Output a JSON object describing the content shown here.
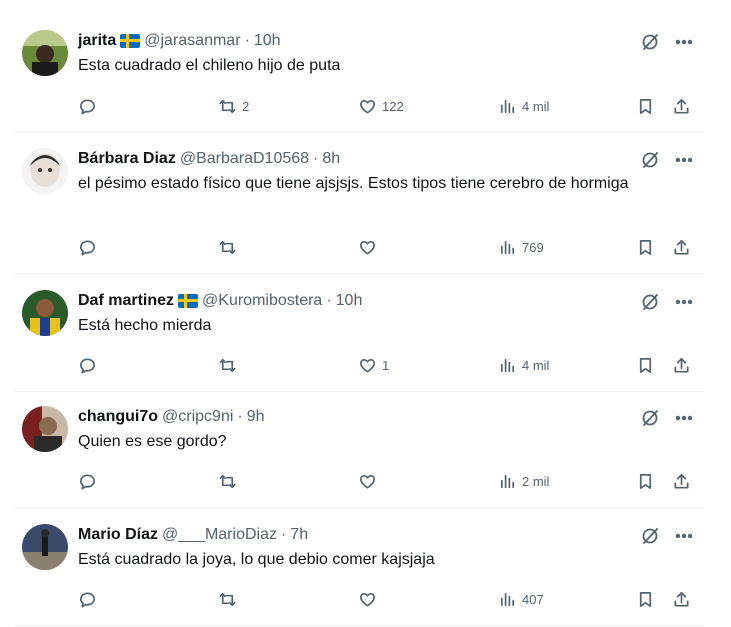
{
  "replies": [
    {
      "name": "jarita",
      "has_flag": true,
      "handle": "@jarasanmar",
      "time": "10h",
      "text": "Esta cuadrado el chileno hijo de puta",
      "retweets": "2",
      "likes": "122",
      "views": "4 mil"
    },
    {
      "name": "Bárbara Diaz",
      "has_flag": false,
      "handle": "@BarbaraD10568",
      "time": "8h",
      "text": "el pésimo estado físico que tiene ajsjsjs. Estos tipos tiene cerebro de hormiga",
      "retweets": "",
      "likes": "",
      "views": "769"
    },
    {
      "name": "Daf martinez",
      "has_flag": true,
      "handle": "@Kuromibostera",
      "time": "10h",
      "text": "Está hecho mierda",
      "retweets": "",
      "likes": "1",
      "views": "4 mil"
    },
    {
      "name": "changui7o",
      "has_flag": false,
      "handle": "@cripc9ni",
      "time": "9h",
      "text": "Quien es ese gordo?",
      "retweets": "",
      "likes": "",
      "views": "2 mil"
    },
    {
      "name": "Mario Díaz",
      "has_flag": false,
      "handle": "@___MarioDiaz",
      "time": "7h",
      "text": "Está cuadrado la joya, lo que debio comer kajsjaja",
      "retweets": "",
      "likes": "",
      "views": "407"
    }
  ],
  "separator": "·",
  "icons": {
    "grok": "grok-icon",
    "more": "more-icon",
    "reply": "reply-icon",
    "retweet": "retweet-icon",
    "like": "heart-icon",
    "views": "views-icon",
    "bookmark": "bookmark-icon",
    "share": "share-icon"
  },
  "colors": {
    "text": "#0f1419",
    "secondary": "#536471",
    "divider": "#eff3f4",
    "flag_blue": "#0a6bbd",
    "flag_yellow": "#f4c80f"
  }
}
